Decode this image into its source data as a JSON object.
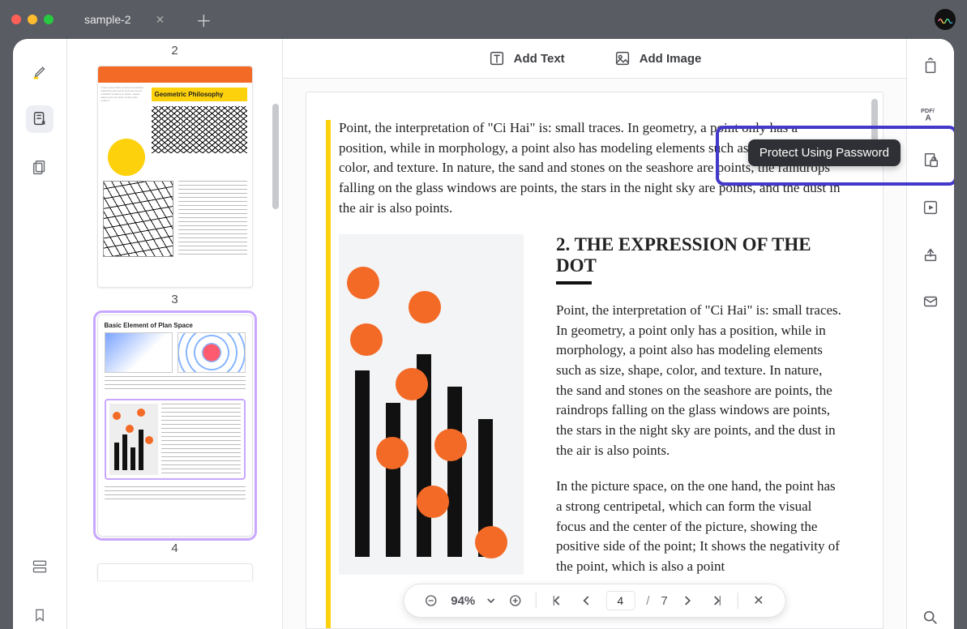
{
  "titlebar": {
    "tab_label": "sample-2"
  },
  "leftrail": {
    "tools": [
      "highlighter",
      "annotate",
      "pages"
    ],
    "bottom_tools": [
      "form-fields",
      "bookmark"
    ]
  },
  "thumbnails": {
    "labels": [
      "2",
      "3",
      "4"
    ],
    "page2_heading": "Geometric Philosophy",
    "page3_heading": "Basic Element of Plan Space"
  },
  "topbar": {
    "add_text": "Add Text",
    "add_image": "Add Image"
  },
  "document": {
    "p1": "Point, the interpretation of \"Ci Hai\" is: small traces. In geometry, a point only has a position, while in morphology, a point also has modeling elements such as size, shape, color, and texture. In nature, the sand and stones on the seashore are points, the raindrops falling on the glass windows are points, the stars in the night sky are points, and the dust in the air is also points.",
    "h2": "2. THE EXPRESSION OF THE DOT",
    "p2": "Point, the interpretation of \"Ci Hai\" is: small traces. In geometry, a point only has a position, while in morphology, a point also has modeling elements such as size, shape, color, and texture. In nature, the sand and stones on the seashore are points, the raindrops falling on the glass windows are points, the stars in the night sky are points, and the dust in the air is also points.",
    "p3": "In the picture space, on the one hand, the point has a strong centripetal, which can form the visual focus and the center of the picture, showing the positive side of the point; It shows the negativity of the point, which is also a point"
  },
  "pager": {
    "zoom": "94%",
    "page": "4",
    "sep": "/",
    "total": "7"
  },
  "rightrail": {
    "tools": [
      "rotate",
      "pdfa",
      "protect",
      "slideshow",
      "share",
      "mail"
    ],
    "bottom": "search"
  },
  "tooltip": {
    "text": "Protect Using Password"
  }
}
